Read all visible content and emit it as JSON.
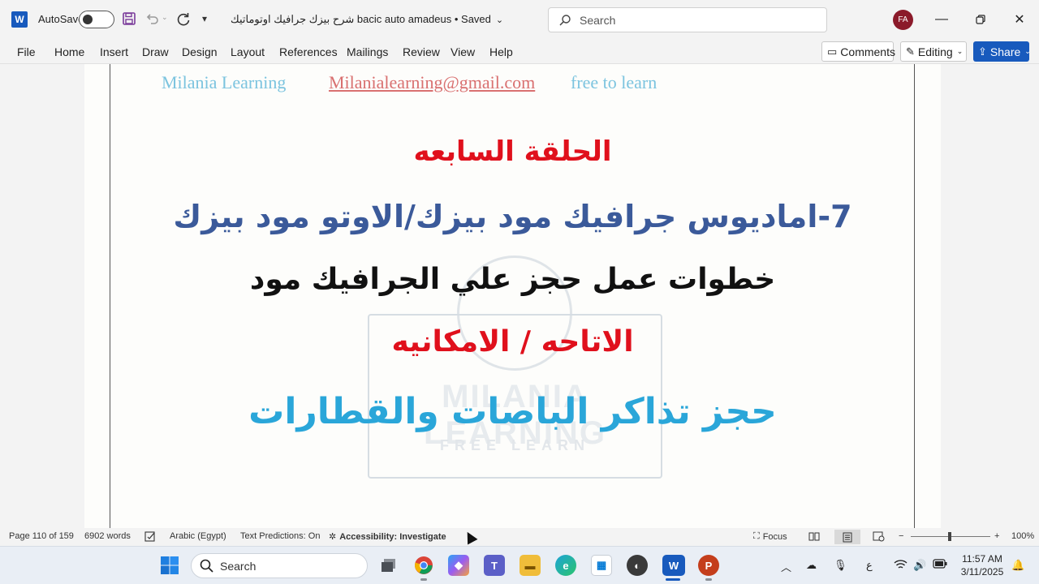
{
  "titlebar": {
    "app_letter": "W",
    "autosave_label": "AutoSave",
    "autosave_on": false,
    "document_title": "شرح بيزك جرافيك اوتوماتيك bacic auto   amadeus • Saved",
    "search_placeholder": "Search",
    "avatar_initials": "FA",
    "avatar_color": "#8b1a2a"
  },
  "ribbon": {
    "tabs": [
      "File",
      "Home",
      "Insert",
      "Draw",
      "Design",
      "Layout",
      "References",
      "Mailings",
      "Review",
      "View",
      "Help"
    ],
    "comments_label": "Comments",
    "editing_label": "Editing",
    "share_label": "Share",
    "accent_color": "#185abd"
  },
  "document": {
    "header": {
      "left": "Milania Learning",
      "middle": "Milanialearning@gmail.com",
      "right": "free to learn"
    },
    "lines": [
      "الحلقة السابعه",
      "7-اماديوس جرافيك مود بيزك/الاوتو مود بيزك",
      "خطوات عمل حجز علي الجرافيك مود",
      "الاتاحه / الامكانيه",
      "حجز تذاكر الباصات والقطارات"
    ],
    "watermark": {
      "line1": "MILANIA LEARNING",
      "line2": "FREE LEARN"
    }
  },
  "statusbar": {
    "page": "Page 110 of 159",
    "words": "6902 words",
    "language": "Arabic (Egypt)",
    "text_predictions": "Text Predictions: On",
    "accessibility": "Accessibility: Investigate",
    "focus": "Focus",
    "zoom": "100%"
  },
  "taskbar": {
    "search_placeholder": "Search",
    "input_indicator": "ع",
    "time": "11:57 AM",
    "date": "3/11/2025"
  }
}
